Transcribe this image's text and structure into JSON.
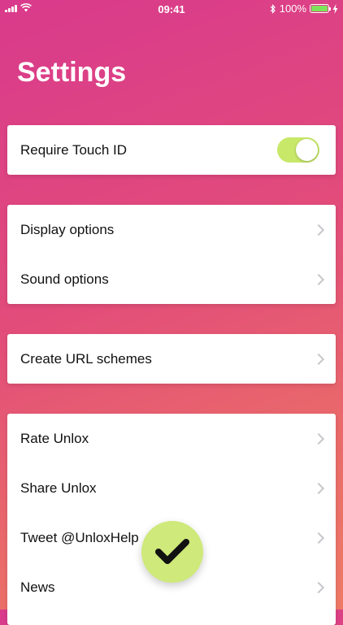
{
  "status_bar": {
    "time": "09:41",
    "battery_label": "100%",
    "battery_level": 1.0,
    "icons": [
      "signal-icon",
      "wifi-icon",
      "bluetooth-icon",
      "battery-icon",
      "charging-icon"
    ]
  },
  "title": "Settings",
  "colors": {
    "background_top": "#d93a8c",
    "background_bottom": "#ee7a66",
    "toggle_on": "#c8e86a",
    "fab": "#cfe97a"
  },
  "security": {
    "require_touch_id_label": "Require Touch ID",
    "require_touch_id_enabled": true
  },
  "options": {
    "display_label": "Display options",
    "sound_label": "Sound options"
  },
  "advanced": {
    "url_schemes_label": "Create URL schemes"
  },
  "social": {
    "rate_label": "Rate Unlox",
    "share_label": "Share Unlox",
    "tweet_label": "Tweet @UnloxHelp",
    "news_label": "News"
  },
  "fab": {
    "icon": "checkmark-icon"
  }
}
